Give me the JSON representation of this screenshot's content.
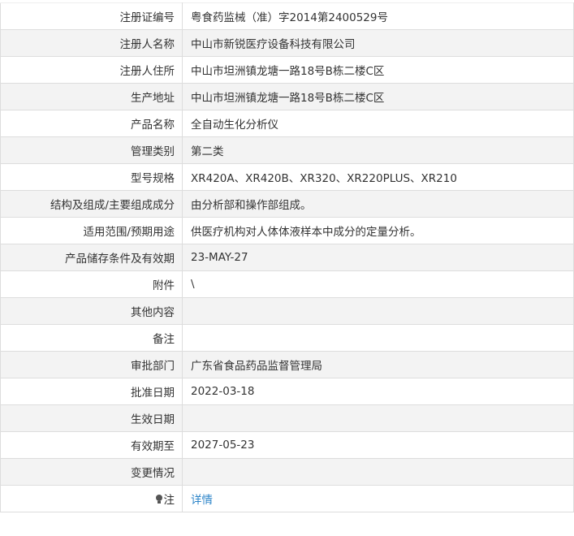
{
  "rows": [
    {
      "label": "注册证编号",
      "value": "粤食药监械（准）字2014第2400529号"
    },
    {
      "label": "注册人名称",
      "value": "中山市新锐医疗设备科技有限公司"
    },
    {
      "label": "注册人住所",
      "value": "中山市坦洲镇龙塘一路18号B栋二楼C区"
    },
    {
      "label": "生产地址",
      "value": "中山市坦洲镇龙塘一路18号B栋二楼C区"
    },
    {
      "label": "产品名称",
      "value": "全自动生化分析仪"
    },
    {
      "label": "管理类别",
      "value": "第二类"
    },
    {
      "label": "型号规格",
      "value": "XR420A、XR420B、XR320、XR220PLUS、XR210"
    },
    {
      "label": "结构及组成/主要组成成分",
      "value": "由分析部和操作部组成。"
    },
    {
      "label": "适用范围/预期用途",
      "value": "供医疗机构对人体体液样本中成分的定量分析。"
    },
    {
      "label": "产品储存条件及有效期",
      "value": "23-MAY-27"
    },
    {
      "label": "附件",
      "value": "\\"
    },
    {
      "label": "其他内容",
      "value": ""
    },
    {
      "label": "备注",
      "value": ""
    },
    {
      "label": "审批部门",
      "value": "广东省食品药品监督管理局"
    },
    {
      "label": "批准日期",
      "value": "2022-03-18"
    },
    {
      "label": "生效日期",
      "value": ""
    },
    {
      "label": "有效期至",
      "value": "2027-05-23"
    },
    {
      "label": "变更情况",
      "value": ""
    }
  ],
  "note": {
    "label": "注",
    "icon": "lightbulb-icon",
    "link_text": "详情",
    "link_color": "#2a83c8"
  }
}
